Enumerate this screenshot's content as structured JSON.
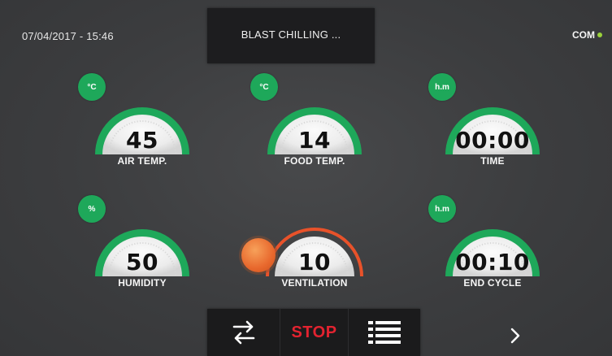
{
  "status_bar": {
    "datetime": "07/04/2017 - 15:46",
    "title": "BLAST CHILLING ...",
    "com_label": "COM",
    "com_dot_color": "#9bd23a"
  },
  "gauges": [
    {
      "id": "air-temp",
      "unit": "°C",
      "value": "45",
      "label": "AIR TEMP.",
      "arc_color": "#1ea85a",
      "style": "green"
    },
    {
      "id": "food-temp",
      "unit": "°C",
      "value": "14",
      "label": "FOOD TEMP.",
      "arc_color": "#1ea85a",
      "style": "green"
    },
    {
      "id": "time",
      "unit": "h.m",
      "value": "00:00",
      "label": "TIME",
      "arc_color": "#1ea85a",
      "style": "green"
    },
    {
      "id": "humidity",
      "unit": "%",
      "value": "50",
      "label": "HUMIDITY",
      "arc_color": "#1ea85a",
      "style": "green"
    },
    {
      "id": "ventilation",
      "unit": "",
      "value": "10",
      "label": "VENTILATION",
      "arc_color": "#e8522a",
      "style": "orange"
    },
    {
      "id": "end-cycle",
      "unit": "h.m",
      "value": "00:10",
      "label": "END CYCLE",
      "arc_color": "#1ea85a",
      "style": "green"
    }
  ],
  "toolbar": {
    "swap_icon": "swap-arrows-icon",
    "stop_label": "STOP",
    "list_icon": "list-icon"
  },
  "nav": {
    "next_icon": "chevron-right-icon"
  },
  "colors": {
    "accent_green": "#1ea85a",
    "accent_orange": "#e8522a",
    "stop_red": "#e32330"
  }
}
